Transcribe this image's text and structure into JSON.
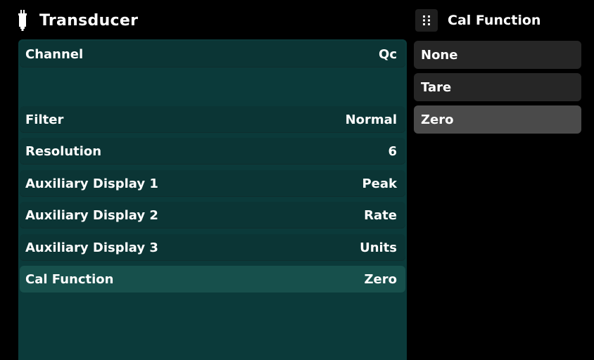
{
  "header": {
    "title": "Transducer",
    "icon": "transducer-icon"
  },
  "panel": {
    "rows": [
      {
        "label": "Channel",
        "value": "Qc"
      },
      {
        "label": "",
        "value": ""
      },
      {
        "label": "Filter",
        "value": "Normal"
      },
      {
        "label": "Resolution",
        "value": "6"
      },
      {
        "label": "Auxiliary Display 1",
        "value": "Peak"
      },
      {
        "label": "Auxiliary Display 2",
        "value": "Rate"
      },
      {
        "label": "Auxiliary Display 3",
        "value": "Units"
      },
      {
        "label": "Cal Function",
        "value": "Zero"
      }
    ],
    "selected_index": 7
  },
  "popup": {
    "title": "Cal Function",
    "icon": "grip-icon",
    "options": [
      "None",
      "Tare",
      "Zero"
    ],
    "selected": "Zero"
  },
  "colors": {
    "background": "#000000",
    "panel": "#0b3a3a",
    "row": "#0b3535",
    "row_selected": "#17504c",
    "option": "#262626",
    "option_selected": "#4a4a4a"
  }
}
